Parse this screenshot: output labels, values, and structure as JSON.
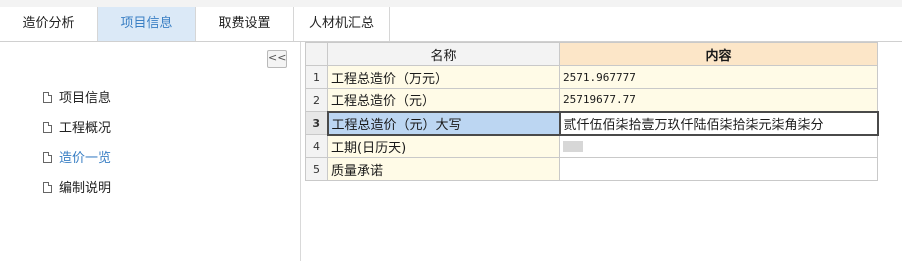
{
  "tabs": [
    {
      "label": "造价分析"
    },
    {
      "label": "项目信息"
    },
    {
      "label": "取费设置"
    },
    {
      "label": "人材机汇总"
    }
  ],
  "sidebar": {
    "collapse_label": "<<",
    "items": [
      {
        "label": "项目信息"
      },
      {
        "label": "工程概况"
      },
      {
        "label": "造价一览"
      },
      {
        "label": "编制说明"
      }
    ]
  },
  "grid": {
    "columns": {
      "name": "名称",
      "content": "内容"
    },
    "rows": [
      {
        "num": "1",
        "name": "工程总造价（万元）",
        "value": "2571.967777"
      },
      {
        "num": "2",
        "name": "工程总造价（元）",
        "value": "25719677.77"
      },
      {
        "num": "3",
        "name": "工程总造价（元）大写",
        "value": "贰仟伍佰柒拾壹万玖仟陆佰柒拾柒元柒角柒分"
      },
      {
        "num": "4",
        "name": "工期(日历天)",
        "value": ""
      },
      {
        "num": "5",
        "name": "质量承诺",
        "value": ""
      }
    ]
  },
  "colors": {
    "accent": "#3a7fc4",
    "active_tab_bg": "#dbe9f7",
    "header_content_bg": "#fce6c8",
    "row_bg": "#fffbe7",
    "selected_cell": "#bcd6f2"
  }
}
